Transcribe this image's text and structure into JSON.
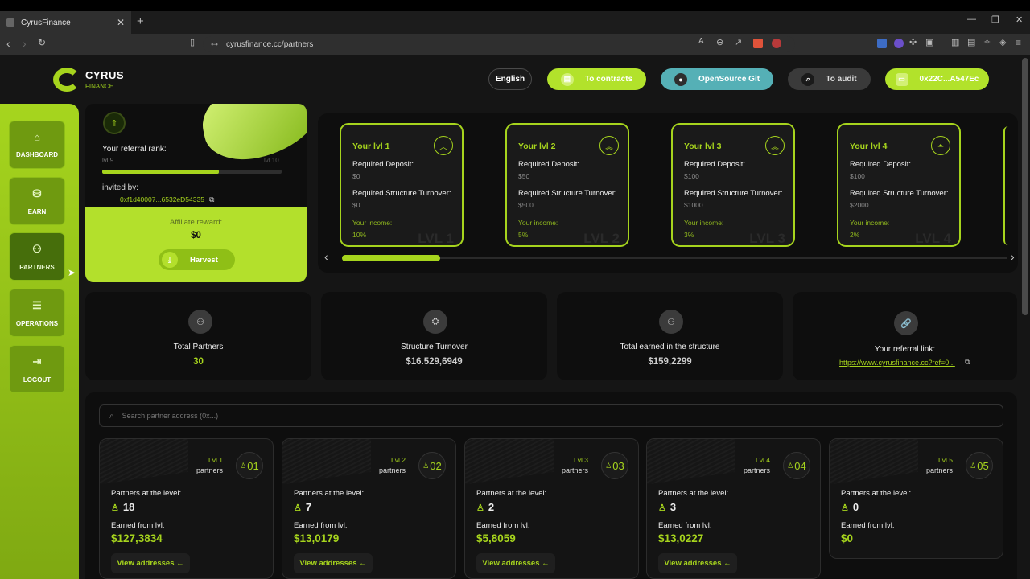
{
  "browser": {
    "tab_title": "CyrusFinance",
    "tab_close": "✕",
    "new_tab": "+",
    "url": "cyrusfinance.cc/partners"
  },
  "header": {
    "logo_title": "CYRUS",
    "logo_subtitle": "FINANCE",
    "language": "English",
    "contracts": "To contracts",
    "git": "OpenSource Git",
    "audit": "To audit",
    "wallet": "0x22C...A547Ec"
  },
  "sidebar": {
    "items": [
      {
        "label": "DASHBOARD",
        "icon": "home-icon"
      },
      {
        "label": "EARN",
        "icon": "earn-icon"
      },
      {
        "label": "PARTNERS",
        "icon": "partners-icon"
      },
      {
        "label": "OPERATIONS",
        "icon": "operations-icon"
      },
      {
        "label": "LOGOUT",
        "icon": "logout-icon"
      }
    ]
  },
  "rank": {
    "label": "Your referral rank:",
    "current_level": "lvl 9",
    "next_level": "lvl 10",
    "progress": 0.65,
    "invited_label": "invited by:",
    "invited_address": "0xf1d40007...6532eD54335",
    "reward_label": "Affiliate reward:",
    "reward_value": "$0",
    "harvest": "Harvest"
  },
  "levels": {
    "deposit_label": "Required Deposit:",
    "turnover_label": "Required Structure Turnover:",
    "income_label": "Your income:",
    "cards": [
      {
        "title": "Your lvl 1",
        "deposit": "$0",
        "turnover": "$0",
        "income": "10%",
        "watermark": "LVL 1"
      },
      {
        "title": "Your lvl 2",
        "deposit": "$50",
        "turnover": "$500",
        "income": "5%",
        "watermark": "LVL 2"
      },
      {
        "title": "Your lvl 3",
        "deposit": "$100",
        "turnover": "$1000",
        "income": "3%",
        "watermark": "LVL 3"
      },
      {
        "title": "Your lvl 4",
        "deposit": "$100",
        "turnover": "$2000",
        "income": "2%",
        "watermark": "LVL 4"
      }
    ]
  },
  "stats": {
    "total_partners_label": "Total Partners",
    "total_partners_value": "30",
    "turnover_label": "Structure Turnover",
    "turnover_value": "$16.529,6949",
    "earned_label": "Total earned in the structure",
    "earned_value": "$159,2299",
    "link_label": "Your referral link:",
    "link_value": "https://www.cyrusfinance.cc?ref=0..."
  },
  "partners": {
    "search_placeholder": "Search partner address (0x...)",
    "partners_word": "partners",
    "at_level_label": "Partners at the level:",
    "earned_label": "Earned from lvl:",
    "view_label": "View addresses ←",
    "cards": [
      {
        "level": "Lvl 1",
        "num": "01",
        "count": "18",
        "earned": "$127,3834"
      },
      {
        "level": "Lvl 2",
        "num": "02",
        "count": "7",
        "earned": "$13,0179"
      },
      {
        "level": "Lvl 3",
        "num": "03",
        "count": "2",
        "earned": "$5,8059"
      },
      {
        "level": "Lvl 4",
        "num": "04",
        "count": "3",
        "earned": "$13,0227"
      },
      {
        "level": "Lvl 5",
        "num": "05",
        "count": "0",
        "earned": "$0"
      }
    ]
  }
}
